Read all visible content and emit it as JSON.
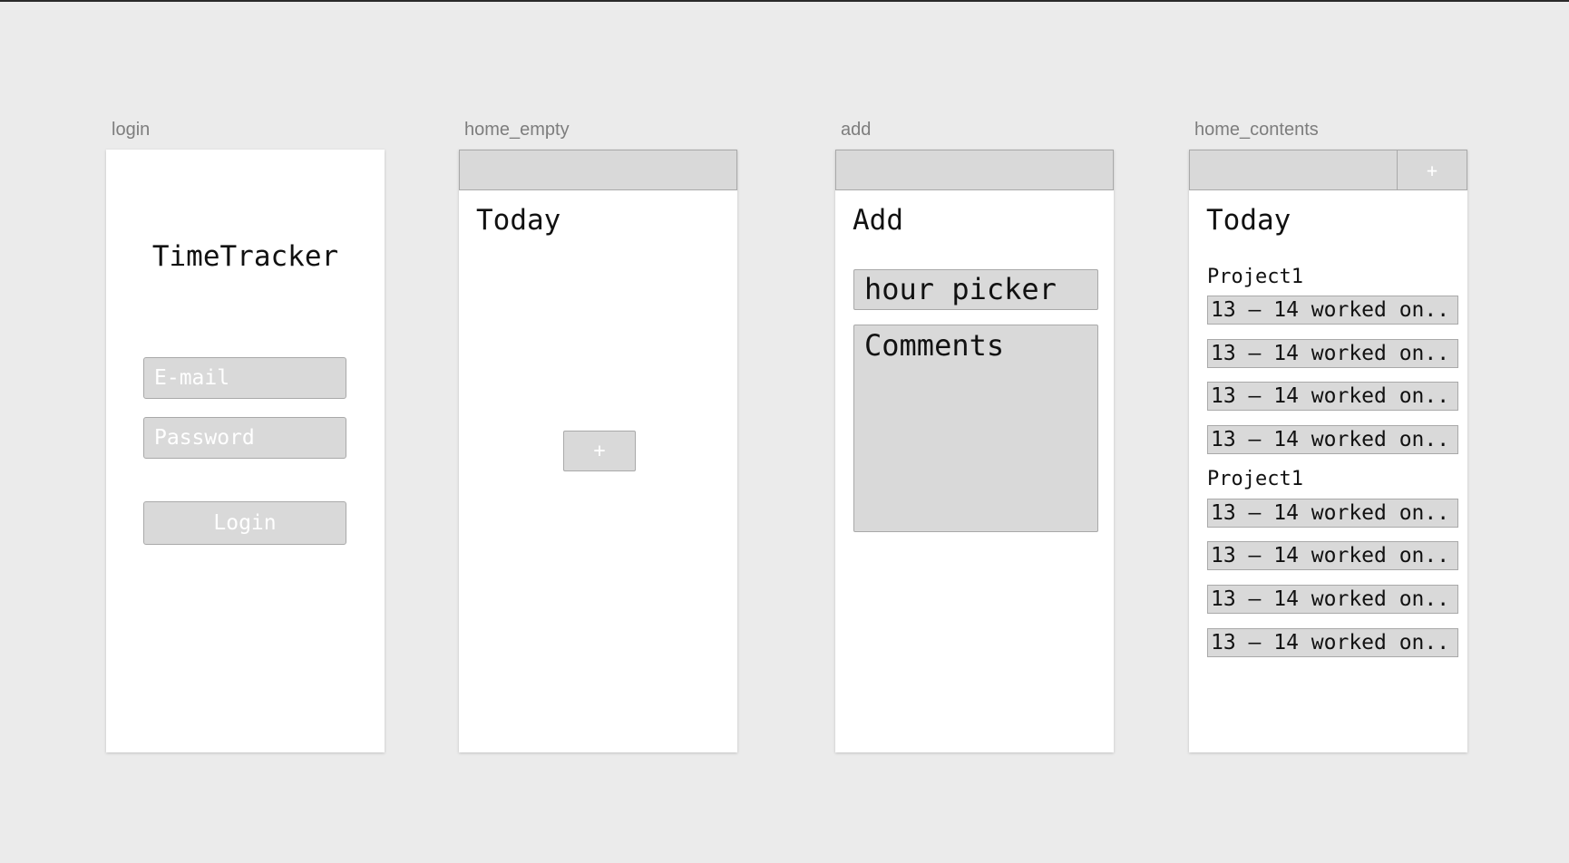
{
  "frames": {
    "login": {
      "label": "login",
      "app_title": "TimeTracker",
      "email_placeholder": "E-mail",
      "password_placeholder": "Password",
      "login_label": "Login"
    },
    "home_empty": {
      "label": "home_empty",
      "heading": "Today",
      "add_label": "+"
    },
    "add": {
      "label": "add",
      "heading": "Add",
      "hour_picker": "hour picker",
      "comments": "Comments"
    },
    "home_contents": {
      "label": "home_contents",
      "heading": "Today",
      "add_label": "+",
      "groups": [
        {
          "project": "Project1",
          "entries": [
            "13 – 14 worked on..",
            "13 – 14 worked on..",
            "13 – 14 worked on..",
            "13 – 14 worked on.."
          ]
        },
        {
          "project": "Project1",
          "entries": [
            "13 – 14 worked on..",
            "13 – 14 worked on..",
            "13 – 14 worked on..",
            "13 – 14 worked on.."
          ]
        }
      ]
    }
  },
  "colors": {
    "canvas": "#ebebeb",
    "placeholder_fill": "#d9d9d9",
    "border": "#a9a9a9",
    "label": "#7d7d7d"
  }
}
